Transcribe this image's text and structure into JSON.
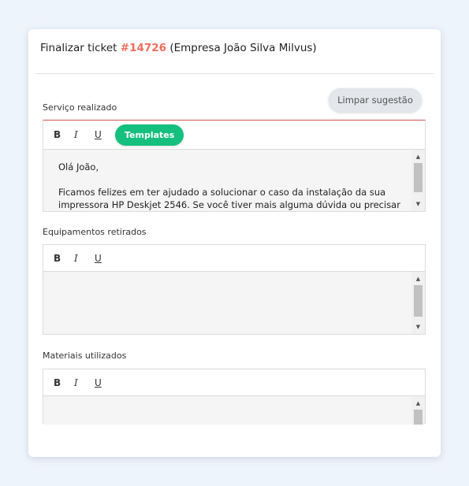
{
  "header": {
    "prefix": "Finalizar ticket",
    "ticket_number": "#14726",
    "company": "(Empresa João Silva Milvus)"
  },
  "actions": {
    "clear_suggestion": "Limpar sugestão"
  },
  "toolbar": {
    "bold": "B",
    "italic": "I",
    "underline": "U",
    "templates": "Templates"
  },
  "fields": {
    "service": {
      "label": "Serviço realizado",
      "paragraphs": [
        "Olá João,",
        "Ficamos felizes em ter ajudado a solucionar o caso da instalação da sua impressora HP Deskjet 2546. Se você tiver mais alguma dúvida ou precisar de"
      ]
    },
    "equipment": {
      "label": "Equipamentos retirados"
    },
    "materials": {
      "label": "Materiais utilizados"
    }
  },
  "colors": {
    "ticket_accent": "#f26d5b",
    "templates_button": "#15bf7e",
    "active_editor_border": "#d9534f"
  }
}
